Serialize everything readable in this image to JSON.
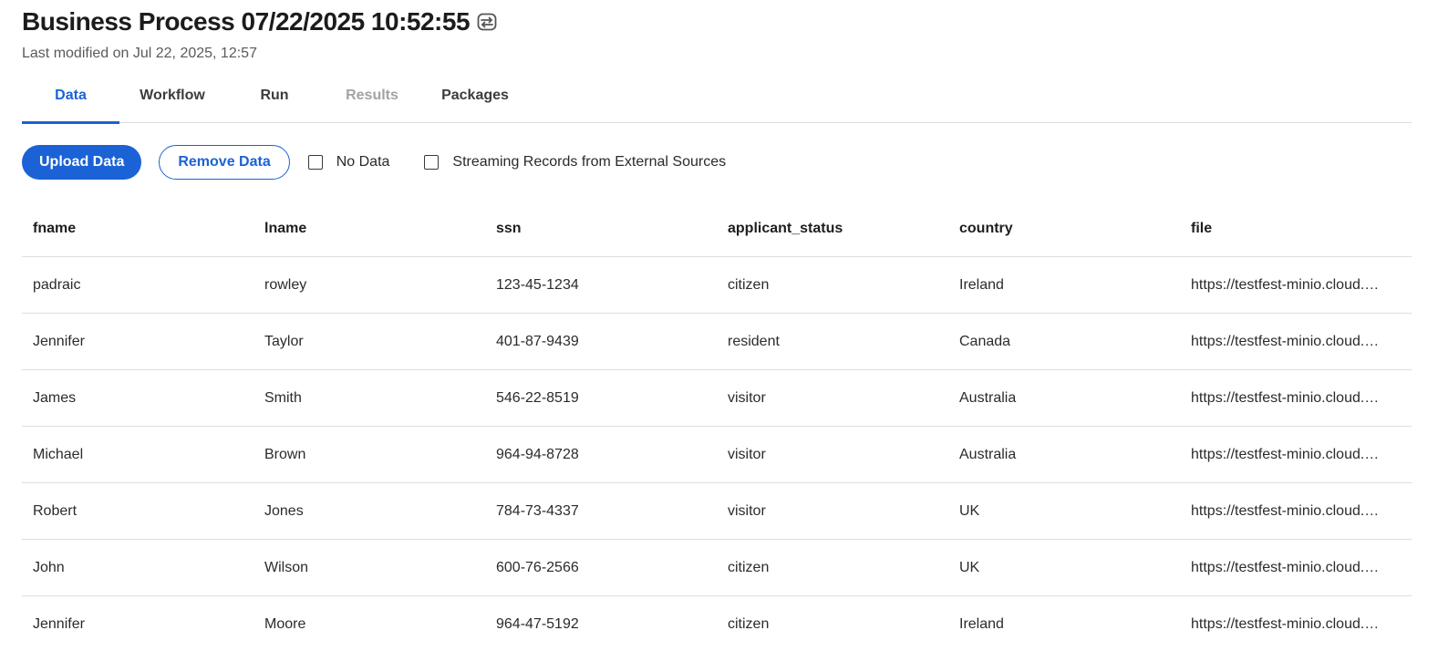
{
  "header": {
    "title": "Business Process 07/22/2025 10:52:55",
    "subtitle": "Last modified on Jul 22, 2025, 12:57",
    "title_icon": "compare-arrows-icon"
  },
  "tabs": [
    {
      "label": "Data",
      "state": "active"
    },
    {
      "label": "Workflow",
      "state": "normal"
    },
    {
      "label": "Run",
      "state": "normal"
    },
    {
      "label": "Results",
      "state": "disabled"
    },
    {
      "label": "Packages",
      "state": "normal"
    }
  ],
  "toolbar": {
    "upload_label": "Upload Data",
    "remove_label": "Remove Data",
    "no_data_label": "No Data",
    "no_data_checked": false,
    "streaming_label": "Streaming Records from External Sources",
    "streaming_checked": false
  },
  "table": {
    "columns": [
      "fname",
      "lname",
      "ssn",
      "applicant_status",
      "country",
      "file"
    ],
    "rows": [
      [
        "padraic",
        "rowley",
        "123-45-1234",
        "citizen",
        "Ireland",
        "https://testfest-minio.cloud.…"
      ],
      [
        "Jennifer",
        "Taylor",
        "401-87-9439",
        "resident",
        "Canada",
        "https://testfest-minio.cloud.…"
      ],
      [
        "James",
        "Smith",
        "546-22-8519",
        "visitor",
        "Australia",
        "https://testfest-minio.cloud.…"
      ],
      [
        "Michael",
        "Brown",
        "964-94-8728",
        "visitor",
        "Australia",
        "https://testfest-minio.cloud.…"
      ],
      [
        "Robert",
        "Jones",
        "784-73-4337",
        "visitor",
        "UK",
        "https://testfest-minio.cloud.…"
      ],
      [
        "John",
        "Wilson",
        "600-76-2566",
        "citizen",
        "UK",
        "https://testfest-minio.cloud.…"
      ],
      [
        "Jennifer",
        "Moore",
        "964-47-5192",
        "citizen",
        "Ireland",
        "https://testfest-minio.cloud.…"
      ]
    ]
  },
  "colors": {
    "accent": "#1a62d6",
    "disabled_text": "#a3a3a3",
    "divider": "#dedede"
  }
}
